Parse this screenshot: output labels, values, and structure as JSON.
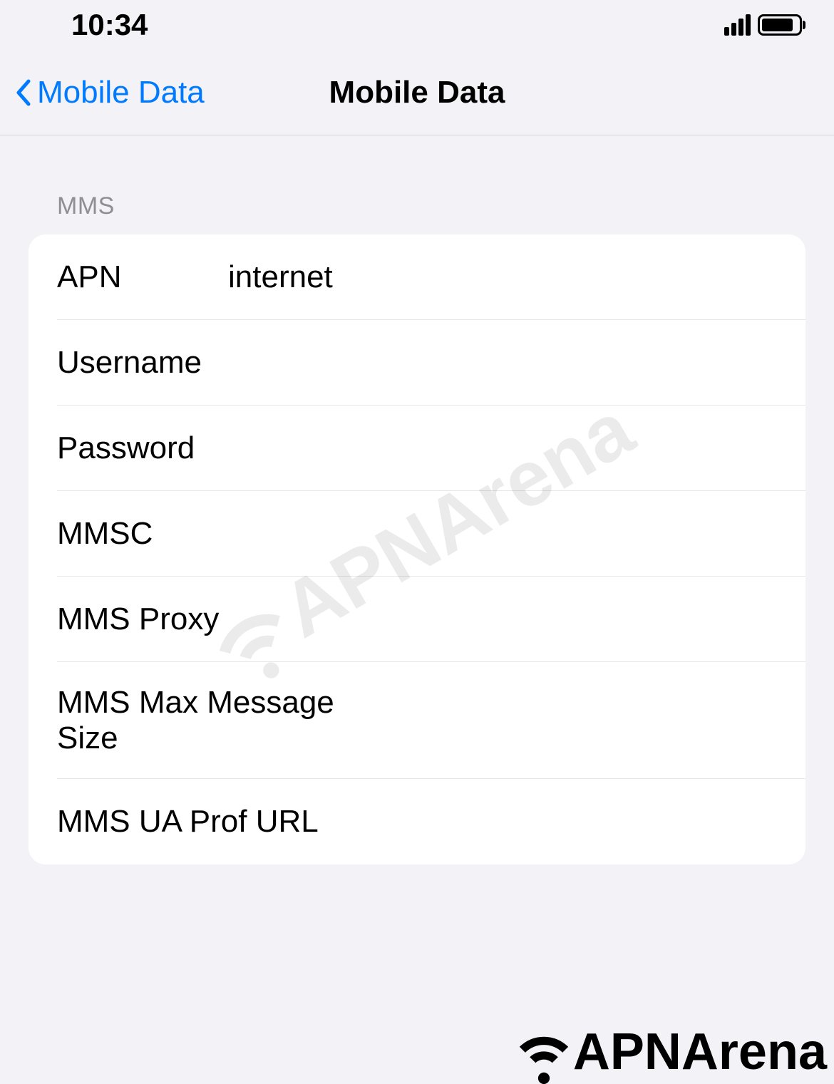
{
  "statusBar": {
    "time": "10:34"
  },
  "navBar": {
    "backLabel": "Mobile Data",
    "title": "Mobile Data"
  },
  "section": {
    "header": "MMS",
    "rows": [
      {
        "label": "APN",
        "value": "internet"
      },
      {
        "label": "Username",
        "value": ""
      },
      {
        "label": "Password",
        "value": ""
      },
      {
        "label": "MMSC",
        "value": ""
      },
      {
        "label": "MMS Proxy",
        "value": ""
      },
      {
        "label": "MMS Max Message Size",
        "value": ""
      },
      {
        "label": "MMS UA Prof URL",
        "value": ""
      }
    ]
  },
  "watermark": "APNArena",
  "footerLogo": "APNArena"
}
